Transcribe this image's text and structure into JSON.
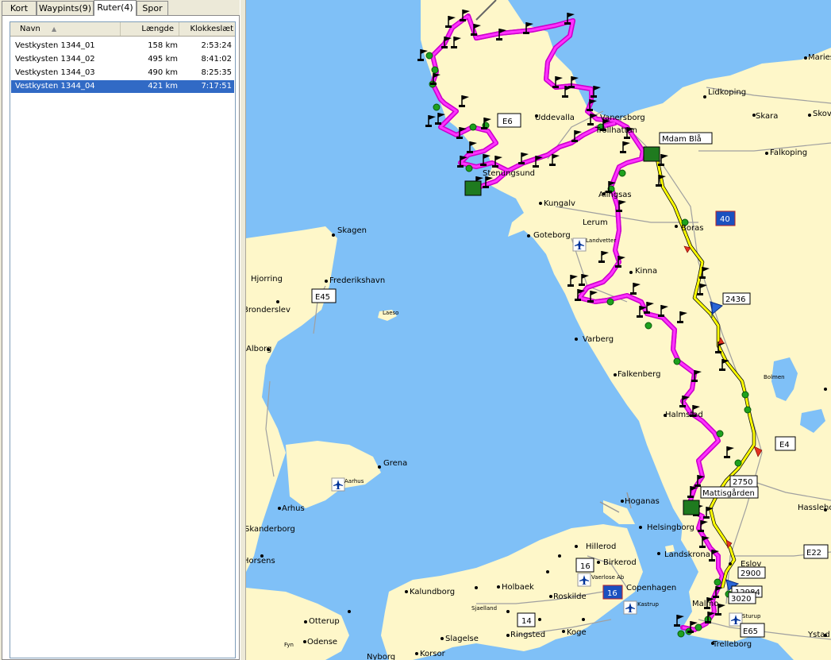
{
  "tabs": [
    "Kort",
    "Waypints(9)",
    "Ruter(4)",
    "Spor"
  ],
  "active_tab": 2,
  "table": {
    "columns": [
      "Navn",
      "Længde",
      "Klokkeslæt"
    ],
    "rows": [
      {
        "name": "Vestkysten 1344_01",
        "length": "158 km",
        "time": "2:53:24",
        "selected": false
      },
      {
        "name": "Vestkysten 1344_02",
        "length": "495 km",
        "time": "8:41:02",
        "selected": false
      },
      {
        "name": "Vestkysten 1344_03",
        "length": "490 km",
        "time": "8:25:35",
        "selected": false
      },
      {
        "name": "Vestkysten 1344_04",
        "length": "421 km",
        "time": "7:17:51",
        "selected": true
      }
    ]
  },
  "map": {
    "colors": {
      "sea": "#7fc0f7",
      "land": "#fef7c9",
      "route_magenta": "#ff33ff",
      "route_yellow": "#ffff00",
      "waypoint_green": "#1ea11e"
    },
    "places": [
      "Uddevalla",
      "Kungalv",
      "Goteborg",
      "Lerum",
      "Alingsas",
      "Boras",
      "Kinna",
      "Varberg",
      "Falkenberg",
      "Halmstad",
      "Hoganas",
      "Helsingborg",
      "Landskrona",
      "Eslov",
      "Malmo",
      "Trelleborg",
      "Ystad",
      "Hassleholm",
      "Lidkoping",
      "Skara",
      "Falkoping",
      "Skovde",
      "Mariestad",
      "Skagen",
      "Frederikshavn",
      "Hjorring",
      "Bronderslev",
      "Alborg",
      "Laeso",
      "Grena",
      "Aarhus",
      "Arhus",
      "Skanderborg",
      "Horsens",
      "Hillerod",
      "Birkerod",
      "Holbaek",
      "Kalundborg",
      "Roskilde",
      "Copenhagen",
      "Koge",
      "Ringsted",
      "Slagelse",
      "Korsor",
      "Nyborg",
      "Odense",
      "Otterup",
      "Fyn",
      "Sjaelland",
      "Kastrup",
      "Sturup",
      "Vaerlose Ab",
      "Landvetter",
      "Bolmen",
      "Vanersborg",
      "Trollhattan",
      "Stenungsund",
      "Mdam Blå",
      "Mattisgården"
    ],
    "place_labels": {
      "uddevalla": "Uddevalla",
      "kungalv": "Kungalv",
      "goteborg": "Goteborg",
      "lerum": "Lerum",
      "alingsas": "Alingsas",
      "boras": "Boras",
      "kinna": "Kinna",
      "varberg": "Varberg",
      "falkenberg": "Falkenberg",
      "halmstad": "Halmstad",
      "hoganas": "Hoganas",
      "helsingborg": "Helsingborg",
      "landskrona": "Landskrona",
      "eslov": "Eslov",
      "malmo": "Malmo",
      "trelleborg": "Trelleborg",
      "ystad": "Ystad",
      "hassleholm": "Hassleholm",
      "lidkoping": "Lidkoping",
      "skara": "Skara",
      "falkoping": "Falkoping",
      "skovde": "Skovde",
      "mariestad": "Mariestad",
      "skagen": "Skagen",
      "frederikshavn": "Frederikshavn",
      "hjorring": "Hjorring",
      "bronderslev": "Bronderslev",
      "alborg": "Alborg",
      "laeso": "Laeso",
      "grena": "Grena",
      "aarhus": "Aarhus",
      "arhus": "Arhus",
      "skanderborg": "Skanderborg",
      "horsens": "Horsens",
      "hillerod": "Hillerod",
      "birkerod": "Birkerod",
      "holbaek": "Holbaek",
      "kalundborg": "Kalundborg",
      "roskilde": "Roskilde",
      "copenhagen": "Copenhagen",
      "koge": "Koge",
      "ringsted": "Ringsted",
      "slagelse": "Slagelse",
      "korsor": "Korsor",
      "nyborg": "Nyborg",
      "odense": "Odense",
      "otterup": "Otterup",
      "fyn": "Fyn",
      "sjaelland": "Sjaelland",
      "kastrup": "Kastrup",
      "sturup": "Sturup",
      "vaerlose": "Vaerlose Ab",
      "landvetter": "Landvetter",
      "bolmen": "Bolmen",
      "vanersborg": "Vanersborg",
      "trollhattan": "Trollhattan",
      "stenungsund": "Stenungsund"
    },
    "road_shields": {
      "e6": "E6",
      "e45": "E45",
      "e4": "E4",
      "e22": "E22",
      "e65": "E65",
      "r40": "40",
      "r16a": "16",
      "r16b": "16",
      "r14": "14"
    },
    "point_labels": {
      "mdam": "Mdam Blå",
      "mattis": "Mattisgården",
      "n2436": "2436",
      "n2750": "2750",
      "n2900": "2900",
      "n3020": "3020",
      "n12984": "12984"
    }
  }
}
